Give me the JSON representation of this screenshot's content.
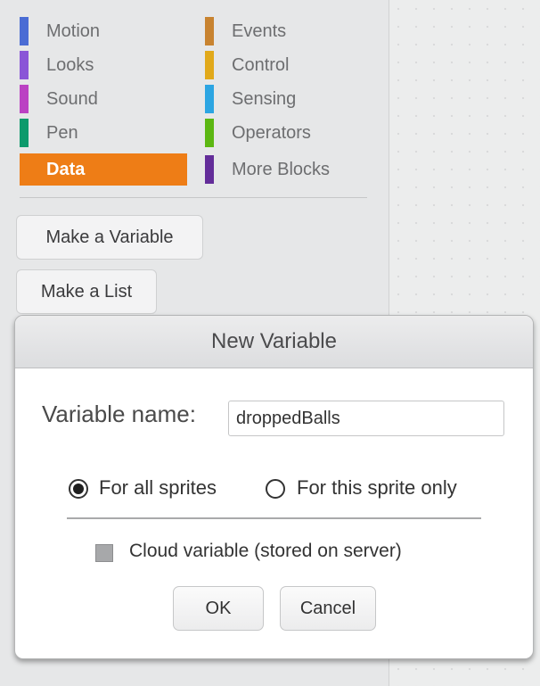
{
  "categories": [
    {
      "label": "Motion",
      "color": "#4a6cd4"
    },
    {
      "label": "Looks",
      "color": "#8a55d7"
    },
    {
      "label": "Sound",
      "color": "#bb42c3"
    },
    {
      "label": "Pen",
      "color": "#0e9a6c"
    },
    {
      "label": "Data",
      "color": "#ee7d16",
      "selected": true
    },
    {
      "label": "Events",
      "color": "#c88330"
    },
    {
      "label": "Control",
      "color": "#e1a91a"
    },
    {
      "label": "Sensing",
      "color": "#2ca5e2"
    },
    {
      "label": "Operators",
      "color": "#5cb712"
    },
    {
      "label": "More Blocks",
      "color": "#632d99"
    }
  ],
  "palette": {
    "make_variable_label": "Make a Variable",
    "make_list_label": "Make a List"
  },
  "dialog": {
    "title": "New Variable",
    "variable_name_label": "Variable name:",
    "variable_name_value": "droppedBalls",
    "radio_all_label": "For all sprites",
    "radio_this_label": "For this sprite only",
    "selected_scope": "For all sprites",
    "cloud_label": "Cloud variable (stored on server)",
    "cloud_checked": false,
    "ok_label": "OK",
    "cancel_label": "Cancel"
  }
}
